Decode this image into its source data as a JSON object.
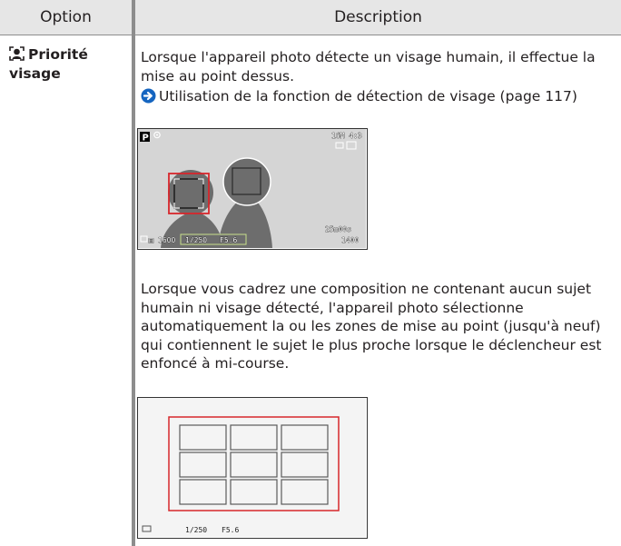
{
  "table": {
    "header_option": "Option",
    "header_description": "Description"
  },
  "option": {
    "icon": "face-priority-icon",
    "name": "Priorité visage"
  },
  "description": {
    "paragraph1": "Lorsque l'appareil photo détecte un visage humain, il effectue la mise au point dessus.",
    "link_icon": "arrow-right-circle-icon",
    "link_text": "Utilisation de la fonction de détection de visage (page 117)",
    "paragraph2": "Lorsque vous cadrez une composition ne contenant aucun sujet humain ni visage détecté, l'appareil photo sélectionne automatiquement la ou les zones de mise au point (jusqu'à neuf) qui contiennent le sujet le plus proche lorsque le déclencheur est enfoncé à mi-course."
  },
  "screen1": {
    "mode": "P",
    "top_right": "16M 4:3",
    "bottom_iso": "1600",
    "shutter": "1/250",
    "aperture": "F5.6",
    "remaining_time": "25m00s",
    "remaining_shots": "1400"
  },
  "screen2": {
    "shutter": "1/250",
    "aperture": "F5.6"
  },
  "colors": {
    "accent_red": "#d7262b",
    "link_blue": "#1565c0",
    "header_bg": "#e6e6e6",
    "divider": "#8d8d8d"
  }
}
